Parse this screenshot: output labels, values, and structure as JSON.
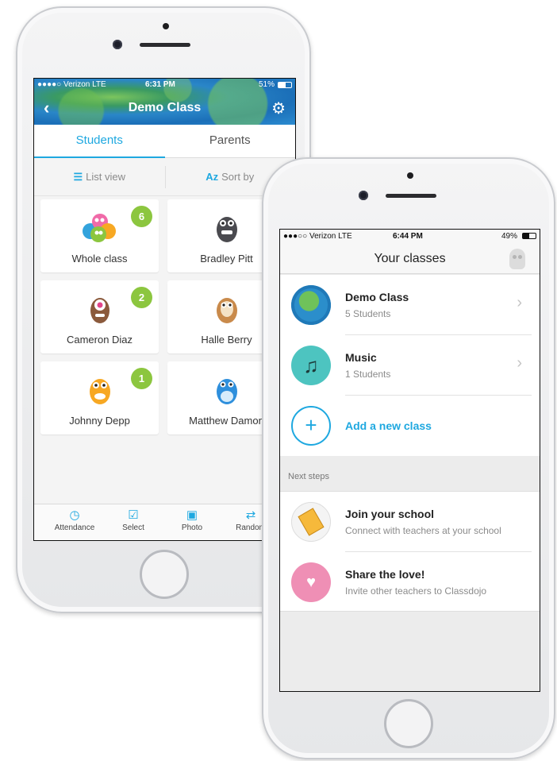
{
  "phone_a": {
    "status": {
      "carrier": "●●●●○ Verizon  LTE",
      "time": "6:31 PM",
      "battery": "51%"
    },
    "header": {
      "title": "Demo Class"
    },
    "tabs": [
      {
        "label": "Students"
      },
      {
        "label": "Parents"
      }
    ],
    "view_bar": {
      "list_view": "List view",
      "sort_icon": "Az",
      "sort_by": "Sort by"
    },
    "cards": [
      {
        "name": "Whole class",
        "badge": "6"
      },
      {
        "name": "Bradley Pitt",
        "badge": ""
      },
      {
        "name": "Cameron Diaz",
        "badge": "2"
      },
      {
        "name": "Halle Berry",
        "badge": ""
      },
      {
        "name": "Johnny Depp",
        "badge": "1"
      },
      {
        "name": "Matthew Damon",
        "badge": ""
      }
    ],
    "tabbar": [
      {
        "label": "Attendance",
        "icon": "clock-icon"
      },
      {
        "label": "Select",
        "icon": "checkbox-icon"
      },
      {
        "label": "Photo",
        "icon": "camera-icon"
      },
      {
        "label": "Random",
        "icon": "shuffle-icon"
      }
    ]
  },
  "phone_b": {
    "status": {
      "carrier": "●●●○○ Verizon  LTE",
      "time": "6:44 PM",
      "battery": "49%"
    },
    "nav": {
      "title": "Your classes"
    },
    "classes": [
      {
        "name": "Demo Class",
        "count": "5 Students",
        "icon": "globe-icon"
      },
      {
        "name": "Music",
        "count": "1 Students",
        "icon": "music-note-icon"
      }
    ],
    "add_class": "Add a new class",
    "next_steps_label": "Next steps",
    "next_steps": [
      {
        "title": "Join your school",
        "subtitle": "Connect with teachers at your school",
        "icon": "ruler-icon"
      },
      {
        "title": "Share the love!",
        "subtitle": "Invite other teachers to Classdojo",
        "icon": "heart-icon"
      }
    ]
  },
  "colors": {
    "accent": "#1ea8e0",
    "badge": "#8cc63f",
    "pink": "#ef8fb5"
  }
}
